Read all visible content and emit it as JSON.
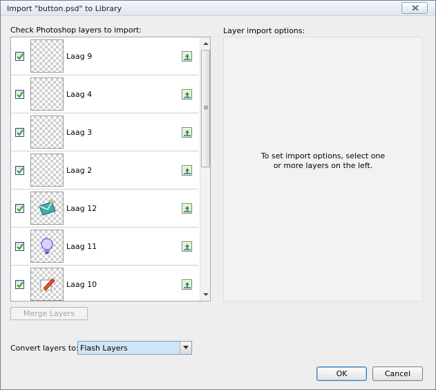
{
  "window": {
    "title": "Import \"button.psd\" to Library"
  },
  "left": {
    "heading": "Check Photoshop layers to import:",
    "layers": [
      {
        "name": "Laag 9",
        "checked": true,
        "thumb": "empty"
      },
      {
        "name": "Laag 4",
        "checked": true,
        "thumb": "empty"
      },
      {
        "name": "Laag 3",
        "checked": true,
        "thumb": "empty"
      },
      {
        "name": "Laag 2",
        "checked": true,
        "thumb": "empty"
      },
      {
        "name": "Laag 12",
        "checked": true,
        "thumb": "envelope-icon"
      },
      {
        "name": "Laag 11",
        "checked": true,
        "thumb": "lightbulb-icon"
      },
      {
        "name": "Laag 10",
        "checked": true,
        "thumb": "pencil-icon"
      }
    ],
    "merge_label": "Merge Layers"
  },
  "right": {
    "heading": "Layer import options:",
    "hint_line1": "To set import options, select one",
    "hint_line2": "or more layers on the left."
  },
  "convert": {
    "label": "Convert layers to:",
    "value": "Flash Layers"
  },
  "buttons": {
    "ok": "OK",
    "cancel": "Cancel"
  },
  "colors": {
    "select_bg": "#cfe6f7",
    "ok_border": "#3c7fb1"
  }
}
